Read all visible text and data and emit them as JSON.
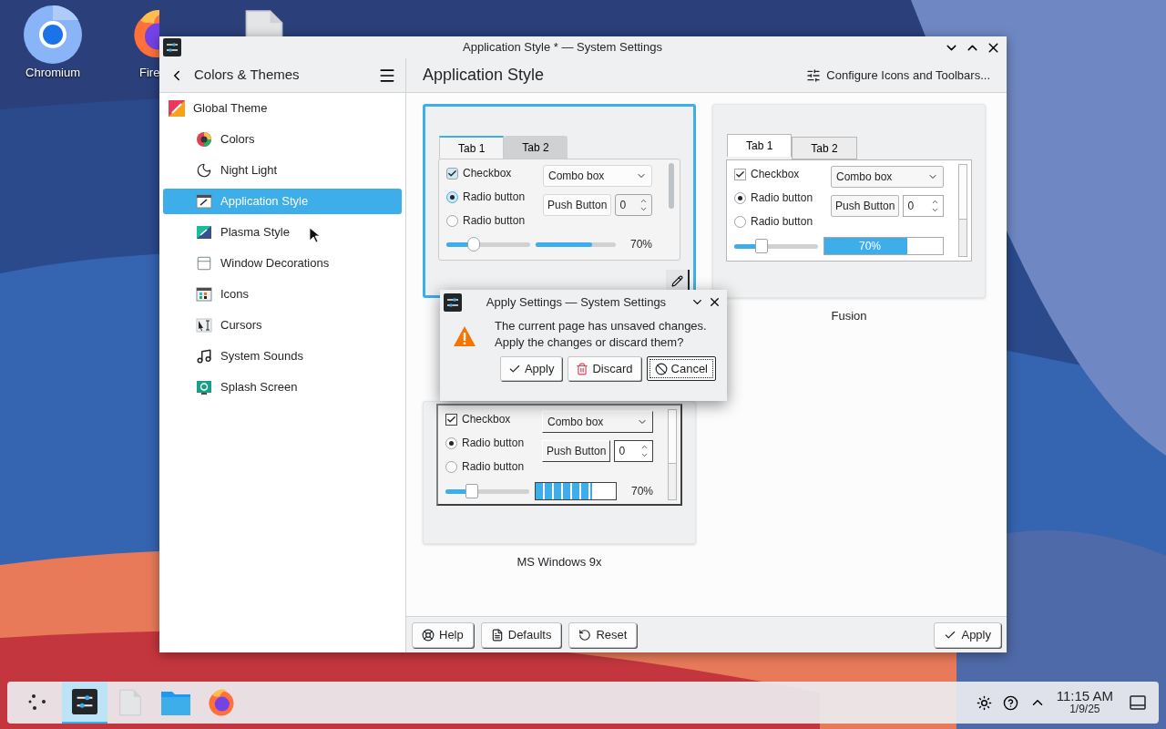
{
  "desktop_icons": [
    {
      "kind": "chromium",
      "label": "Chromium"
    },
    {
      "kind": "firefox",
      "label": "Fire"
    },
    {
      "kind": "file"
    }
  ],
  "window": {
    "title": "Application Style * — System Settings"
  },
  "sidebar": {
    "title": "Colors & Themes",
    "items": [
      {
        "label": "Global Theme",
        "kind": "global",
        "selected": false,
        "children": [
          {
            "label": "Colors",
            "kind": "colors",
            "selected": false
          },
          {
            "label": "Night Light",
            "kind": "night",
            "selected": false
          },
          {
            "label": "Application Style",
            "kind": "appstyle",
            "selected": true
          },
          {
            "label": "Plasma Style",
            "kind": "plasma",
            "selected": false
          },
          {
            "label": "Window Decorations",
            "kind": "windeco",
            "selected": false
          },
          {
            "label": "Icons",
            "kind": "icons",
            "selected": false
          },
          {
            "label": "Cursors",
            "kind": "cursors",
            "selected": false
          },
          {
            "label": "System Sounds",
            "kind": "sounds",
            "selected": false
          },
          {
            "label": "Splash Screen",
            "kind": "splash",
            "selected": false
          }
        ]
      }
    ]
  },
  "page": {
    "title": "Application Style",
    "configure_button": "Configure Icons and Toolbars...",
    "previews": [
      {
        "kind": "breeze",
        "selected": true,
        "tabs": [
          {
            "label": "Tab 1",
            "selected": true
          },
          {
            "label": "Tab 2",
            "selected": false
          }
        ],
        "checkbox": {
          "label": "Checkbox",
          "checked": true
        },
        "radios": [
          {
            "label": "Radio button",
            "selected": true
          },
          {
            "label": "Radio button",
            "selected": false
          }
        ],
        "combo": "Combo box",
        "push_button": "Push Button",
        "spin_value": "0",
        "slider": {
          "level": 0.33
        },
        "progress": {
          "level": 0.7,
          "text": "70%"
        }
      },
      {
        "kind": "fusion",
        "selected": false,
        "caption": "Fusion",
        "tabs": [
          {
            "label": "Tab 1",
            "selected": true
          },
          {
            "label": "Tab 2",
            "selected": false
          }
        ],
        "checkbox": {
          "label": "Checkbox",
          "checked": true
        },
        "radios": [
          {
            "label": "Radio button",
            "selected": true
          },
          {
            "label": "Radio button",
            "selected": false
          }
        ],
        "combo": "Combo box",
        "push_button": "Push Button",
        "spin_value": "0",
        "slider": {
          "level": 0.33
        },
        "progress": {
          "level": 0.7,
          "text": "70%"
        }
      },
      {
        "kind": "windows9x",
        "selected": false,
        "caption": "MS Windows 9x",
        "checkbox": {
          "label": "Checkbox",
          "checked": true
        },
        "radios": [
          {
            "label": "Radio button",
            "selected": true
          },
          {
            "label": "Radio button",
            "selected": false
          }
        ],
        "combo": "Combo box",
        "push_button": "Push Button",
        "spin_value": "0",
        "slider": {
          "level": 0.31
        },
        "progress": {
          "level": 0.7,
          "text": "70%"
        }
      }
    ],
    "buttons": [
      {
        "kind": "help",
        "label": "Help"
      },
      {
        "kind": "defaults",
        "label": "Defaults"
      },
      {
        "kind": "reset",
        "label": "Reset"
      },
      {
        "kind": "apply",
        "label": "Apply"
      }
    ]
  },
  "dialog": {
    "title": "Apply Settings — System Settings",
    "message": "The current page has unsaved changes.\nApply the changes or discard them?",
    "buttons": [
      {
        "kind": "apply",
        "label": "Apply",
        "focused": false
      },
      {
        "kind": "discard",
        "label": "Discard",
        "focused": false
      },
      {
        "kind": "cancel",
        "label": "Cancel",
        "focused": true
      }
    ]
  },
  "taskbar": {
    "tasks": [
      {
        "kind": "settings",
        "selected": true
      },
      {
        "kind": "file",
        "selected": false
      },
      {
        "kind": "folder",
        "selected": false
      },
      {
        "kind": "firefox",
        "selected": false
      }
    ],
    "time": "11:15 AM",
    "date": "1/9/25"
  }
}
